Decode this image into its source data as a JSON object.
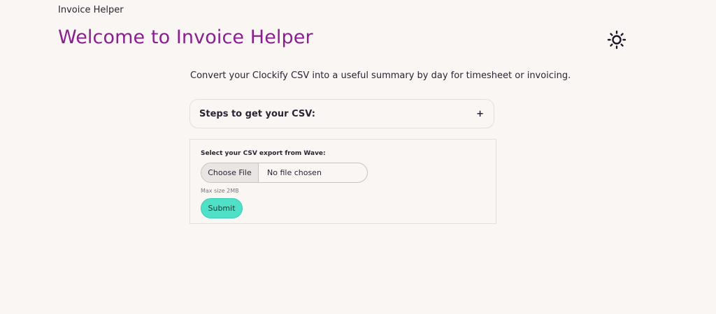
{
  "header": {
    "app_name": "Invoice Helper",
    "title": "Welcome to Invoice Helper",
    "theme_toggle_icon": "sun-icon"
  },
  "main": {
    "intro": "Convert your Clockify CSV into a useful summary by day for timesheet or invoicing.",
    "accordion": {
      "title": "Steps to get your CSV:",
      "expand_symbol": "+"
    },
    "upload": {
      "label": "Select your CSV export from Wave:",
      "choose_button": "Choose File",
      "file_status": "No file chosen",
      "max_size": "Max size 2MB",
      "submit_label": "Submit"
    }
  },
  "colors": {
    "background": "#f9f6f3",
    "title": "#8b1f8f",
    "submit": "#4fe0c7"
  }
}
